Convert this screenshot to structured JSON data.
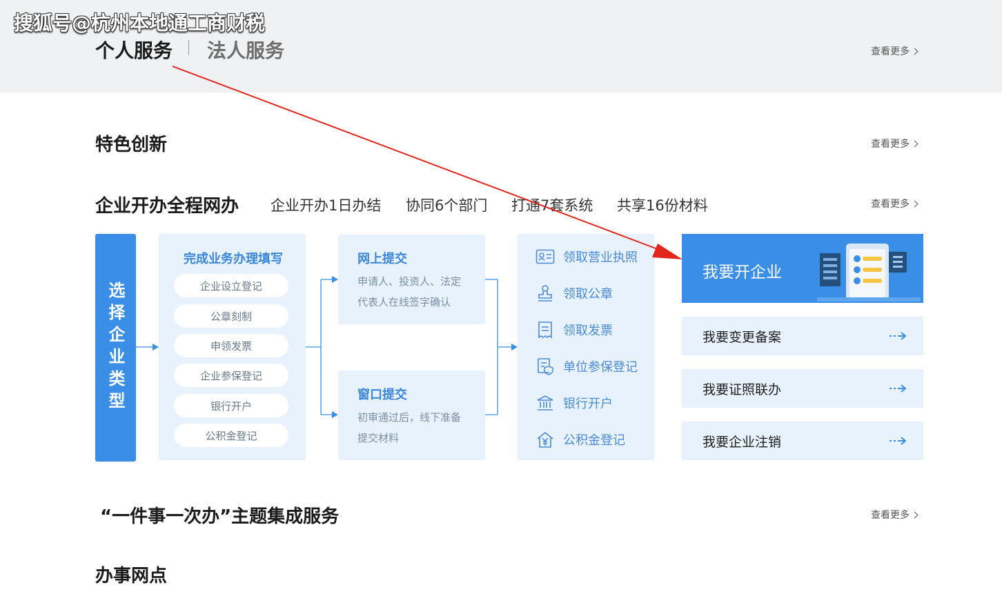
{
  "watermark": "搜狐号@杭州本地通工商财税",
  "service_tabs": [
    {
      "label": "个人服务",
      "active": true
    },
    {
      "label": "法人服务",
      "active": false
    }
  ],
  "view_more": "查看更多",
  "sections": {
    "featured": "特色创新",
    "enterprise": "企业开办全程网办",
    "one_thing": "“一件事一次办”主题集成服务",
    "offices": "办事网点"
  },
  "taglines": [
    "企业开办1日办结",
    "协同6个部门",
    "打通7套系统",
    "共享16份材料"
  ],
  "flow": {
    "choose_label": "选择企业类型",
    "fill": {
      "title": "完成业务办理填写",
      "items": [
        "企业设立登记",
        "公章刻制",
        "申领发票",
        "企业参保登记",
        "银行开户",
        "公积金登记"
      ]
    },
    "online": {
      "title": "网上提交",
      "desc_line1": "申请人、投资人、法定",
      "desc_line2": "代表人在线签字确认"
    },
    "window": {
      "title": "窗口提交",
      "desc_line1": "初审通过后，线下准备",
      "desc_line2": "提交材料"
    },
    "get": {
      "items": [
        {
          "label": "领取营业执照",
          "icon": "license-icon"
        },
        {
          "label": "领取公章",
          "icon": "stamp-icon"
        },
        {
          "label": "领取发票",
          "icon": "invoice-icon"
        },
        {
          "label": "单位参保登记",
          "icon": "insurance-icon"
        },
        {
          "label": "银行开户",
          "icon": "bank-icon"
        },
        {
          "label": "公积金登记",
          "icon": "fund-icon"
        }
      ]
    }
  },
  "actions": {
    "open": "我要开企业",
    "items": [
      "我要变更备案",
      "我要证照联办",
      "我要企业注销"
    ]
  },
  "colors": {
    "accent": "#3a8ee6",
    "panel": "#e8f2fc",
    "annotation_arrow": "#e3261c"
  }
}
